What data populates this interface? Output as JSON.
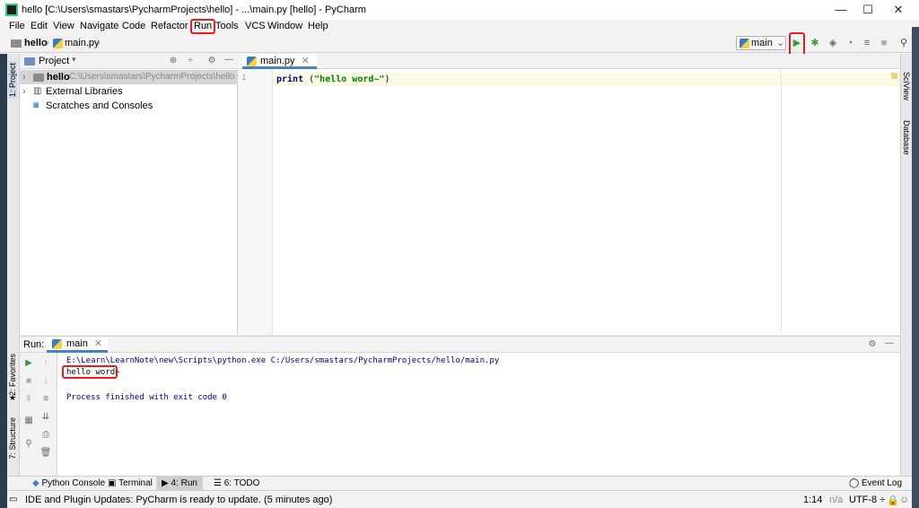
{
  "window": {
    "title": "hello [C:\\Users\\smastars\\PycharmProjects\\hello] - ...\\main.py [hello] - PyCharm",
    "minimize": "—",
    "maximize": "☐",
    "close": "✕"
  },
  "menu": [
    "File",
    "Edit",
    "View",
    "Navigate",
    "Code",
    "Refactor",
    "Run",
    "Tools",
    "VCS",
    "Window",
    "Help"
  ],
  "breadcrumb": {
    "project": "hello",
    "file": "main.py"
  },
  "run_config": {
    "name": "main"
  },
  "left_tools": {
    "project": "1: Project",
    "favorites": "2: Favorites",
    "structure": "7: Structure"
  },
  "right_tools": {
    "sciview": "SciView",
    "database": "Database"
  },
  "project_panel": {
    "title": "Project",
    "items": [
      {
        "name": "hello",
        "path": "C:\\Users\\smastars\\PycharmProjects\\hello"
      },
      {
        "name": "External Libraries"
      },
      {
        "name": "Scratches and Consoles"
      }
    ]
  },
  "editor": {
    "tab": "main.py",
    "line_number": "1",
    "code_fn": "print",
    "code_open": " (",
    "code_str": "\"hello word~\"",
    "code_close": ")"
  },
  "run_panel": {
    "label": "Run:",
    "tab": "main",
    "command": "E:\\Learn\\LearnNote\\new\\Scripts\\python.exe C:/Users/smastars/PycharmProjects/hello/main.py",
    "output": "hello word~",
    "exit": "Process finished with exit code 0"
  },
  "bottom_tabs": {
    "python_console": "Python Console",
    "terminal": "Terminal",
    "run": "4: Run",
    "todo": "6: TODO",
    "event_log": "Event Log"
  },
  "status": {
    "message": "IDE and Plugin Updates: PyCharm is ready to update. (5 minutes ago)",
    "position": "1:14",
    "na": "n/a",
    "encoding": "UTF-8 ÷"
  }
}
